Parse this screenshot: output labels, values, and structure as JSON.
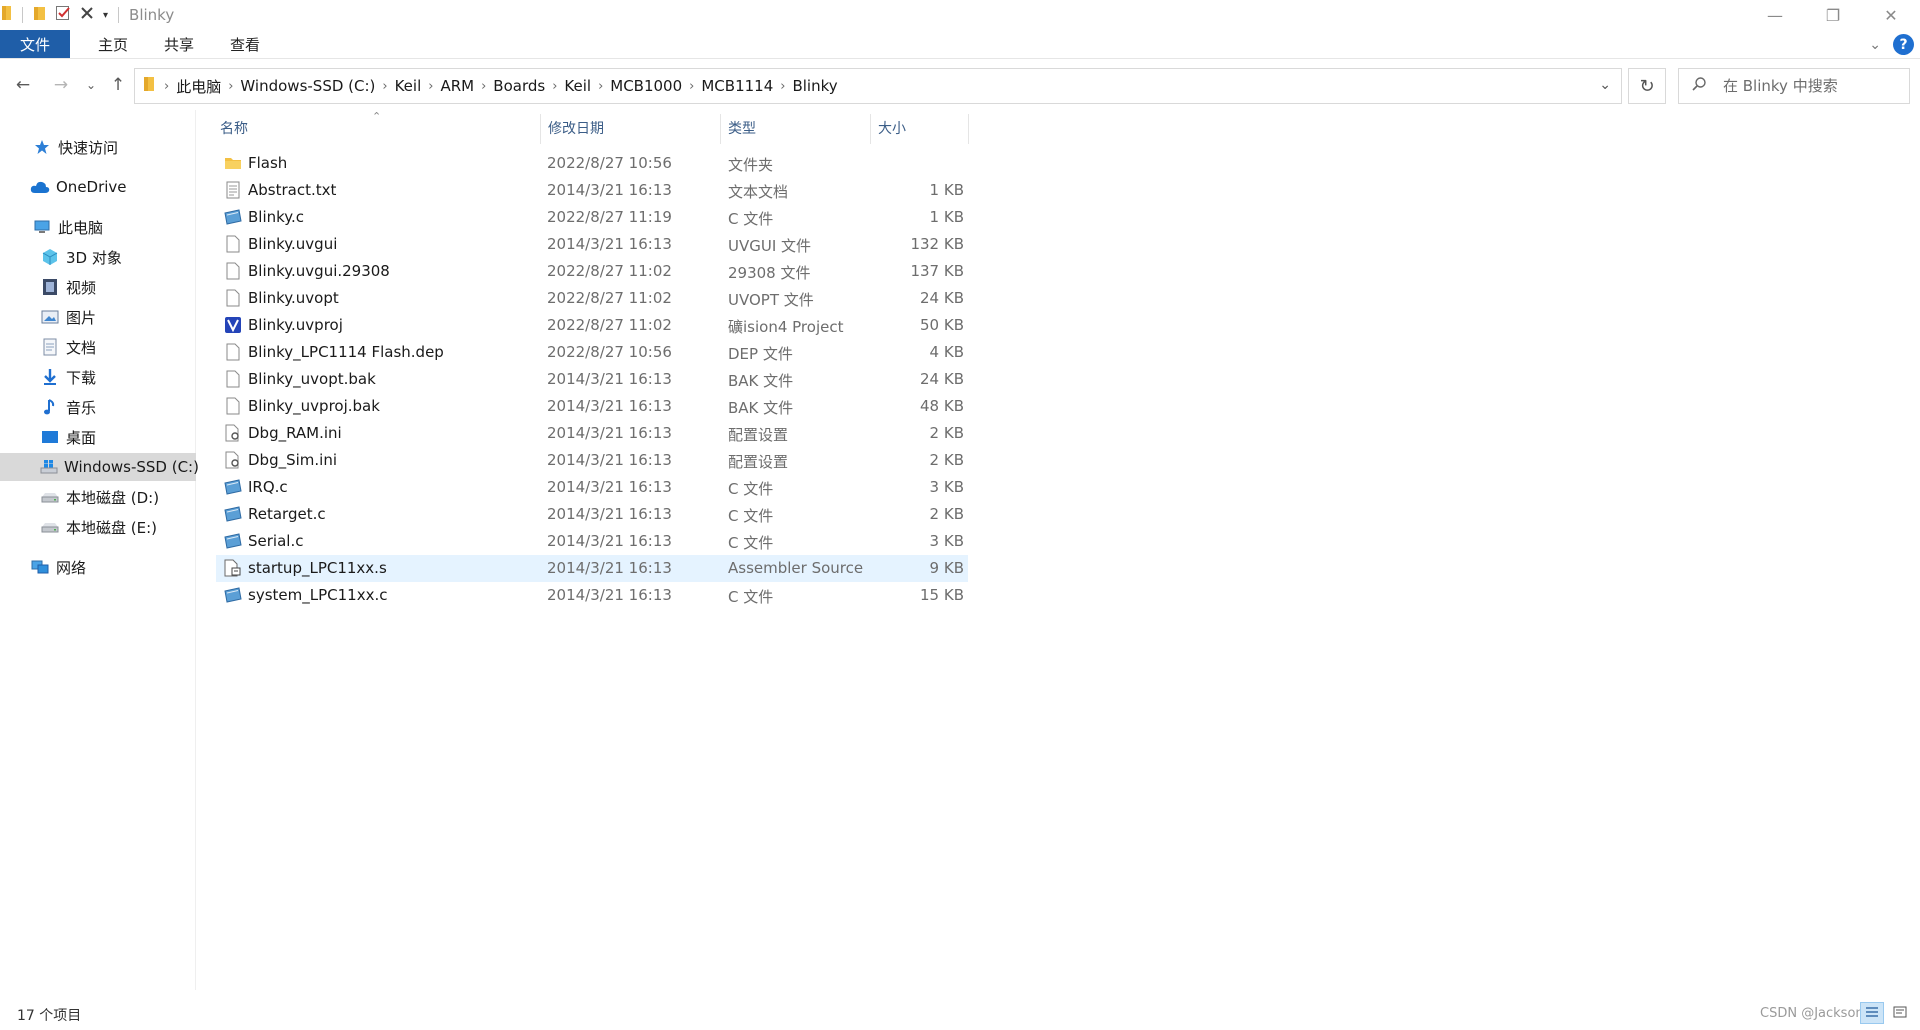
{
  "window": {
    "title": "Blinky"
  },
  "ribbon": {
    "tabs": [
      "文件",
      "主页",
      "共享",
      "查看"
    ]
  },
  "address": {
    "crumbs": [
      "此电脑",
      "Windows-SSD (C:)",
      "Keil",
      "ARM",
      "Boards",
      "Keil",
      "MCB1000",
      "MCB1114",
      "Blinky"
    ]
  },
  "search": {
    "placeholder": "在 Blinky 中搜索"
  },
  "sidebar": {
    "items": [
      {
        "label": "快速访问",
        "icon": "star-icon"
      },
      {
        "label": "OneDrive",
        "icon": "cloud-icon"
      },
      {
        "label": "此电脑",
        "icon": "computer-icon"
      },
      {
        "label": "3D 对象",
        "icon": "cube-icon"
      },
      {
        "label": "视频",
        "icon": "film-icon"
      },
      {
        "label": "图片",
        "icon": "picture-icon"
      },
      {
        "label": "文档",
        "icon": "document-icon"
      },
      {
        "label": "下载",
        "icon": "download-icon"
      },
      {
        "label": "音乐",
        "icon": "music-icon"
      },
      {
        "label": "桌面",
        "icon": "desktop-icon"
      },
      {
        "label": "Windows-SSD (C:)",
        "icon": "windows-drive-icon",
        "selected": true
      },
      {
        "label": "本地磁盘 (D:)",
        "icon": "drive-icon"
      },
      {
        "label": "本地磁盘 (E:)",
        "icon": "drive-icon"
      },
      {
        "label": "网络",
        "icon": "network-icon"
      }
    ]
  },
  "list": {
    "columns": {
      "name": "名称",
      "date": "修改日期",
      "type": "类型",
      "size": "大小"
    },
    "rows": [
      {
        "name": "Flash",
        "date": "2022/8/27 10:56",
        "type": "文件夹",
        "size": "",
        "icon": "folder-icon"
      },
      {
        "name": "Abstract.txt",
        "date": "2014/3/21 16:13",
        "type": "文本文档",
        "size": "1 KB",
        "icon": "text-file-icon"
      },
      {
        "name": "Blinky.c",
        "date": "2022/8/27 11:19",
        "type": "C 文件",
        "size": "1 KB",
        "icon": "c-file-icon"
      },
      {
        "name": "Blinky.uvgui",
        "date": "2014/3/21 16:13",
        "type": "UVGUI 文件",
        "size": "132 KB",
        "icon": "blank-file-icon"
      },
      {
        "name": "Blinky.uvgui.29308",
        "date": "2022/8/27 11:02",
        "type": "29308 文件",
        "size": "137 KB",
        "icon": "blank-file-icon"
      },
      {
        "name": "Blinky.uvopt",
        "date": "2022/8/27 11:02",
        "type": "UVOPT 文件",
        "size": "24 KB",
        "icon": "blank-file-icon"
      },
      {
        "name": "Blinky.uvproj",
        "date": "2022/8/27 11:02",
        "type": "礦ision4 Project",
        "size": "50 KB",
        "icon": "uvision-project-icon"
      },
      {
        "name": "Blinky_LPC1114 Flash.dep",
        "date": "2022/8/27 10:56",
        "type": "DEP 文件",
        "size": "4 KB",
        "icon": "blank-file-icon"
      },
      {
        "name": "Blinky_uvopt.bak",
        "date": "2014/3/21 16:13",
        "type": "BAK 文件",
        "size": "24 KB",
        "icon": "blank-file-icon"
      },
      {
        "name": "Blinky_uvproj.bak",
        "date": "2014/3/21 16:13",
        "type": "BAK 文件",
        "size": "48 KB",
        "icon": "blank-file-icon"
      },
      {
        "name": "Dbg_RAM.ini",
        "date": "2014/3/21 16:13",
        "type": "配置设置",
        "size": "2 KB",
        "icon": "ini-file-icon"
      },
      {
        "name": "Dbg_Sim.ini",
        "date": "2014/3/21 16:13",
        "type": "配置设置",
        "size": "2 KB",
        "icon": "ini-file-icon"
      },
      {
        "name": "IRQ.c",
        "date": "2014/3/21 16:13",
        "type": "C 文件",
        "size": "3 KB",
        "icon": "c-file-icon"
      },
      {
        "name": "Retarget.c",
        "date": "2014/3/21 16:13",
        "type": "C 文件",
        "size": "2 KB",
        "icon": "c-file-icon"
      },
      {
        "name": "Serial.c",
        "date": "2014/3/21 16:13",
        "type": "C 文件",
        "size": "3 KB",
        "icon": "c-file-icon"
      },
      {
        "name": "startup_LPC11xx.s",
        "date": "2014/3/21 16:13",
        "type": "Assembler Source",
        "size": "9 KB",
        "icon": "asm-file-icon",
        "highlighted": true
      },
      {
        "name": "system_LPC11xx.c",
        "date": "2014/3/21 16:13",
        "type": "C 文件",
        "size": "15 KB",
        "icon": "c-file-icon"
      }
    ]
  },
  "status": {
    "count": "17 个项目",
    "watermark": "CSDN @Jacksonlee"
  },
  "colors": {
    "accent": "#1f5ea8",
    "highlight": "#e5f3ff",
    "selected": "#d9d9d9"
  }
}
